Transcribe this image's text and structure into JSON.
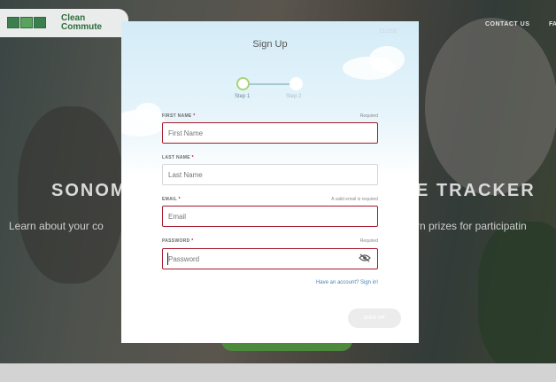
{
  "header": {
    "brand_line1": "Clean",
    "brand_line2": "Commute",
    "nav_contact": "CONTACT US",
    "nav_partial": "FA"
  },
  "hero": {
    "title_left": "SONOM",
    "title_right": "E TRACKER",
    "sub_left": "Learn about your co",
    "sub_right": "rn prizes for participatin"
  },
  "modal": {
    "title": "Sign Up",
    "close_label": "CLOSE",
    "steps": [
      {
        "label": "Step 1",
        "state": "active"
      },
      {
        "label": "Step 2",
        "state": "inactive"
      }
    ],
    "fields": {
      "first_name": {
        "label": "FIRST NAME",
        "required_mark": "*",
        "hint": "Required",
        "placeholder": "First Name",
        "value": "",
        "error": true
      },
      "last_name": {
        "label": "LAST NAME",
        "required_mark": "*",
        "hint": "",
        "placeholder": "Last Name",
        "value": "",
        "error": false
      },
      "email": {
        "label": "EMAIL",
        "required_mark": "*",
        "hint": "A valid email is required",
        "placeholder": "Email",
        "value": "",
        "error": true
      },
      "password": {
        "label": "PASSWORD",
        "required_mark": "*",
        "hint": "Required",
        "placeholder": "Password",
        "value": "",
        "error": true
      }
    },
    "have_account_link": "Have an account? Sign in!",
    "submit_label": "SIGN UP"
  },
  "colors": {
    "error_border": "#a5192b",
    "link": "#4b84b5",
    "step_active": "#a8d47a",
    "brand_green": "#2e6c3d"
  },
  "icons": {
    "password_toggle": "eye-slash-icon",
    "logo": "clean-commute-logo-icon"
  }
}
